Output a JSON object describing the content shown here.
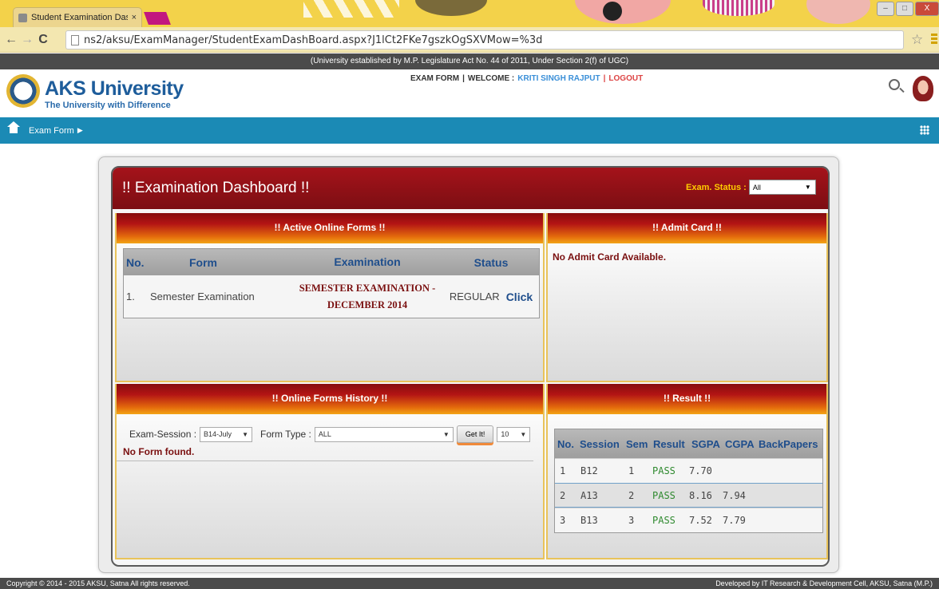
{
  "browser": {
    "tab_title": "Student Examination Dasl",
    "tab_close": "×",
    "url": "ns2/aksu/ExamManager/StudentExamDashBoard.aspx?J1lCt2FKe7gszkOgSXVMow=%3d",
    "back": "←",
    "forward": "→",
    "reload": "C",
    "star": "☆",
    "win_min": "–",
    "win_max": "□",
    "win_close": "X"
  },
  "site": {
    "top_note": "(University established by M.P. Legislature Act No. 44 of 2011, Under Section 2(f) of UGC)",
    "brand": "AKS University",
    "tagline": "The University with Difference",
    "links": {
      "exam_form": "EXAM FORM",
      "sep1": "|",
      "welcome": "WELCOME :",
      "user": "KRITI SINGH RAJPUT",
      "sep2": "|",
      "logout": "LOGOUT"
    },
    "nav": {
      "item": "Exam Form",
      "caret": "▶"
    }
  },
  "dashboard": {
    "title": "!! Examination Dashboard !!",
    "status_label": "Exam. Status :",
    "status_value": "All",
    "caret": "▼",
    "active_forms": {
      "heading": "!! Active Online Forms !!",
      "columns": [
        "No.",
        "Form",
        "Examination",
        "Status"
      ],
      "rows": [
        {
          "no": "1.",
          "form": "Semester Examination",
          "exam_line1": "SEMESTER EXAMINATION -",
          "exam_line2": "DECEMBER 2014",
          "status": "REGULAR",
          "action": "Click"
        }
      ]
    },
    "admit_card": {
      "heading": "!! Admit Card !!",
      "message": "No Admit Card Available."
    },
    "history": {
      "heading": "!! Online Forms History !!",
      "session_label": "Exam-Session :",
      "session_value": "B14-July",
      "type_label": "Form Type :",
      "type_value": "ALL",
      "button": "Get It!",
      "page_size": "10",
      "message": "No Form found."
    },
    "result": {
      "heading": "!! Result !!",
      "columns": [
        "No.",
        "Session",
        "Sem",
        "Result",
        "SGPA",
        "CGPA",
        "BackPapers"
      ],
      "rows": [
        {
          "no": "1",
          "session": "B12",
          "sem": "1",
          "result": "PASS",
          "sgpa": "7.70",
          "cgpa": "",
          "back": ""
        },
        {
          "no": "2",
          "session": "A13",
          "sem": "2",
          "result": "PASS",
          "sgpa": "8.16",
          "cgpa": "7.94",
          "back": ""
        },
        {
          "no": "3",
          "session": "B13",
          "sem": "3",
          "result": "PASS",
          "sgpa": "7.52",
          "cgpa": "7.79",
          "back": ""
        }
      ]
    }
  },
  "footer": {
    "left": "Copyright © 2014 - 2015 AKSU, Satna All rights reserved.",
    "right": "Developed by IT Research & Development Cell, AKSU, Satna (M.P.)"
  }
}
